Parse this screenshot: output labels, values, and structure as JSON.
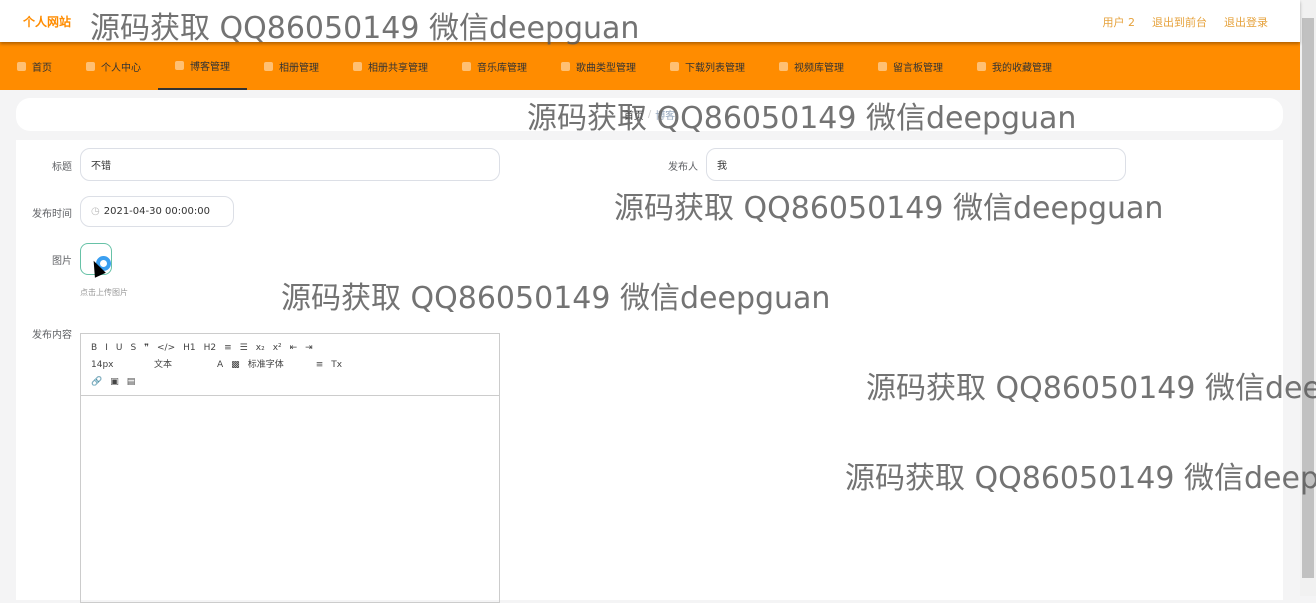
{
  "header": {
    "logo": "个人网站",
    "links": [
      "用户 2",
      "退出到前台",
      "退出登录"
    ]
  },
  "nav": [
    "首页",
    "个人中心",
    "博客管理",
    "相册管理",
    "相册共享管理",
    "音乐库管理",
    "歌曲类型管理",
    "下载列表管理",
    "视频库管理",
    "留言板管理",
    "我的收藏管理"
  ],
  "nav_active": "博客管理",
  "breadcrumb": {
    "home": "首页",
    "sep": "/",
    "current": "博客"
  },
  "form": {
    "title_label": "标题",
    "title_value": "不错",
    "author_label": "发布人",
    "author_value": "我",
    "time_label": "发布时间",
    "time_value": "2021-04-30 00:00:00",
    "image_label": "图片",
    "upload_hint": "点击上传图片",
    "content_label": "发布内容"
  },
  "editor": {
    "row1": [
      "B",
      "I",
      "U",
      "S",
      "❞",
      "</>",
      "H1",
      "H2",
      "≡",
      "☰",
      "x₂",
      "x²",
      "⇤",
      "⇥"
    ],
    "size": "14px",
    "type": "文本",
    "font": "标准字体",
    "row3": [
      "🔗",
      "▣",
      "▤"
    ]
  },
  "watermark": "源码获取 QQ86050149 微信deepguan",
  "colors": {
    "brand": "#ff8c00",
    "link": "#e6a23c"
  }
}
